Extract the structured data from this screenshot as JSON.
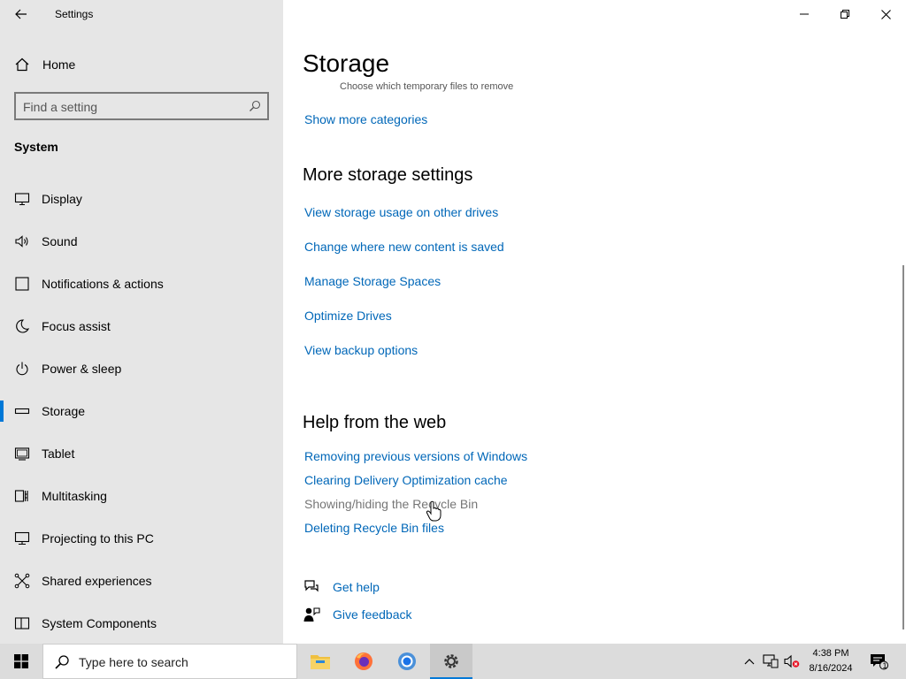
{
  "window": {
    "title": "Settings"
  },
  "sidebar": {
    "home_label": "Home",
    "search_placeholder": "Find a setting",
    "section": "System",
    "items": [
      {
        "label": "Display",
        "icon": "monitor-icon"
      },
      {
        "label": "Sound",
        "icon": "speaker-icon"
      },
      {
        "label": "Notifications & actions",
        "icon": "notification-icon"
      },
      {
        "label": "Focus assist",
        "icon": "moon-icon"
      },
      {
        "label": "Power & sleep",
        "icon": "power-icon"
      },
      {
        "label": "Storage",
        "icon": "storage-drive-icon",
        "active": true
      },
      {
        "label": "Tablet",
        "icon": "tablet-icon"
      },
      {
        "label": "Multitasking",
        "icon": "multitasking-icon"
      },
      {
        "label": "Projecting to this PC",
        "icon": "projecting-icon"
      },
      {
        "label": "Shared experiences",
        "icon": "shared-experiences-icon"
      },
      {
        "label": "System Components",
        "icon": "components-icon"
      }
    ]
  },
  "main": {
    "title": "Storage",
    "clipped_text": "Choose which temporary files to remove",
    "show_more": "Show more categories",
    "more_storage": {
      "heading": "More storage settings",
      "links": [
        "View storage usage on other drives",
        "Change where new content is saved",
        "Manage Storage Spaces",
        "Optimize Drives",
        "View backup options"
      ]
    },
    "help_web": {
      "heading": "Help from the web",
      "links": [
        "Removing previous versions of Windows",
        "Clearing Delivery Optimization cache",
        "Showing/hiding the Recycle Bin",
        "Deleting Recycle Bin files"
      ]
    },
    "get_help": "Get help",
    "give_feedback": "Give feedback"
  },
  "taskbar": {
    "search_text": "Type here to search",
    "apps": [
      "file-explorer-icon",
      "firefox-icon",
      "chrome-icon",
      "settings-gear-icon"
    ],
    "time": "4:38 PM",
    "date": "8/16/2024",
    "notification_count": "1"
  },
  "colors": {
    "accent": "#0078d7",
    "link": "#0067b8",
    "sidebar_bg": "#e6e6e6",
    "taskbar_bg": "#dcdcdc"
  }
}
